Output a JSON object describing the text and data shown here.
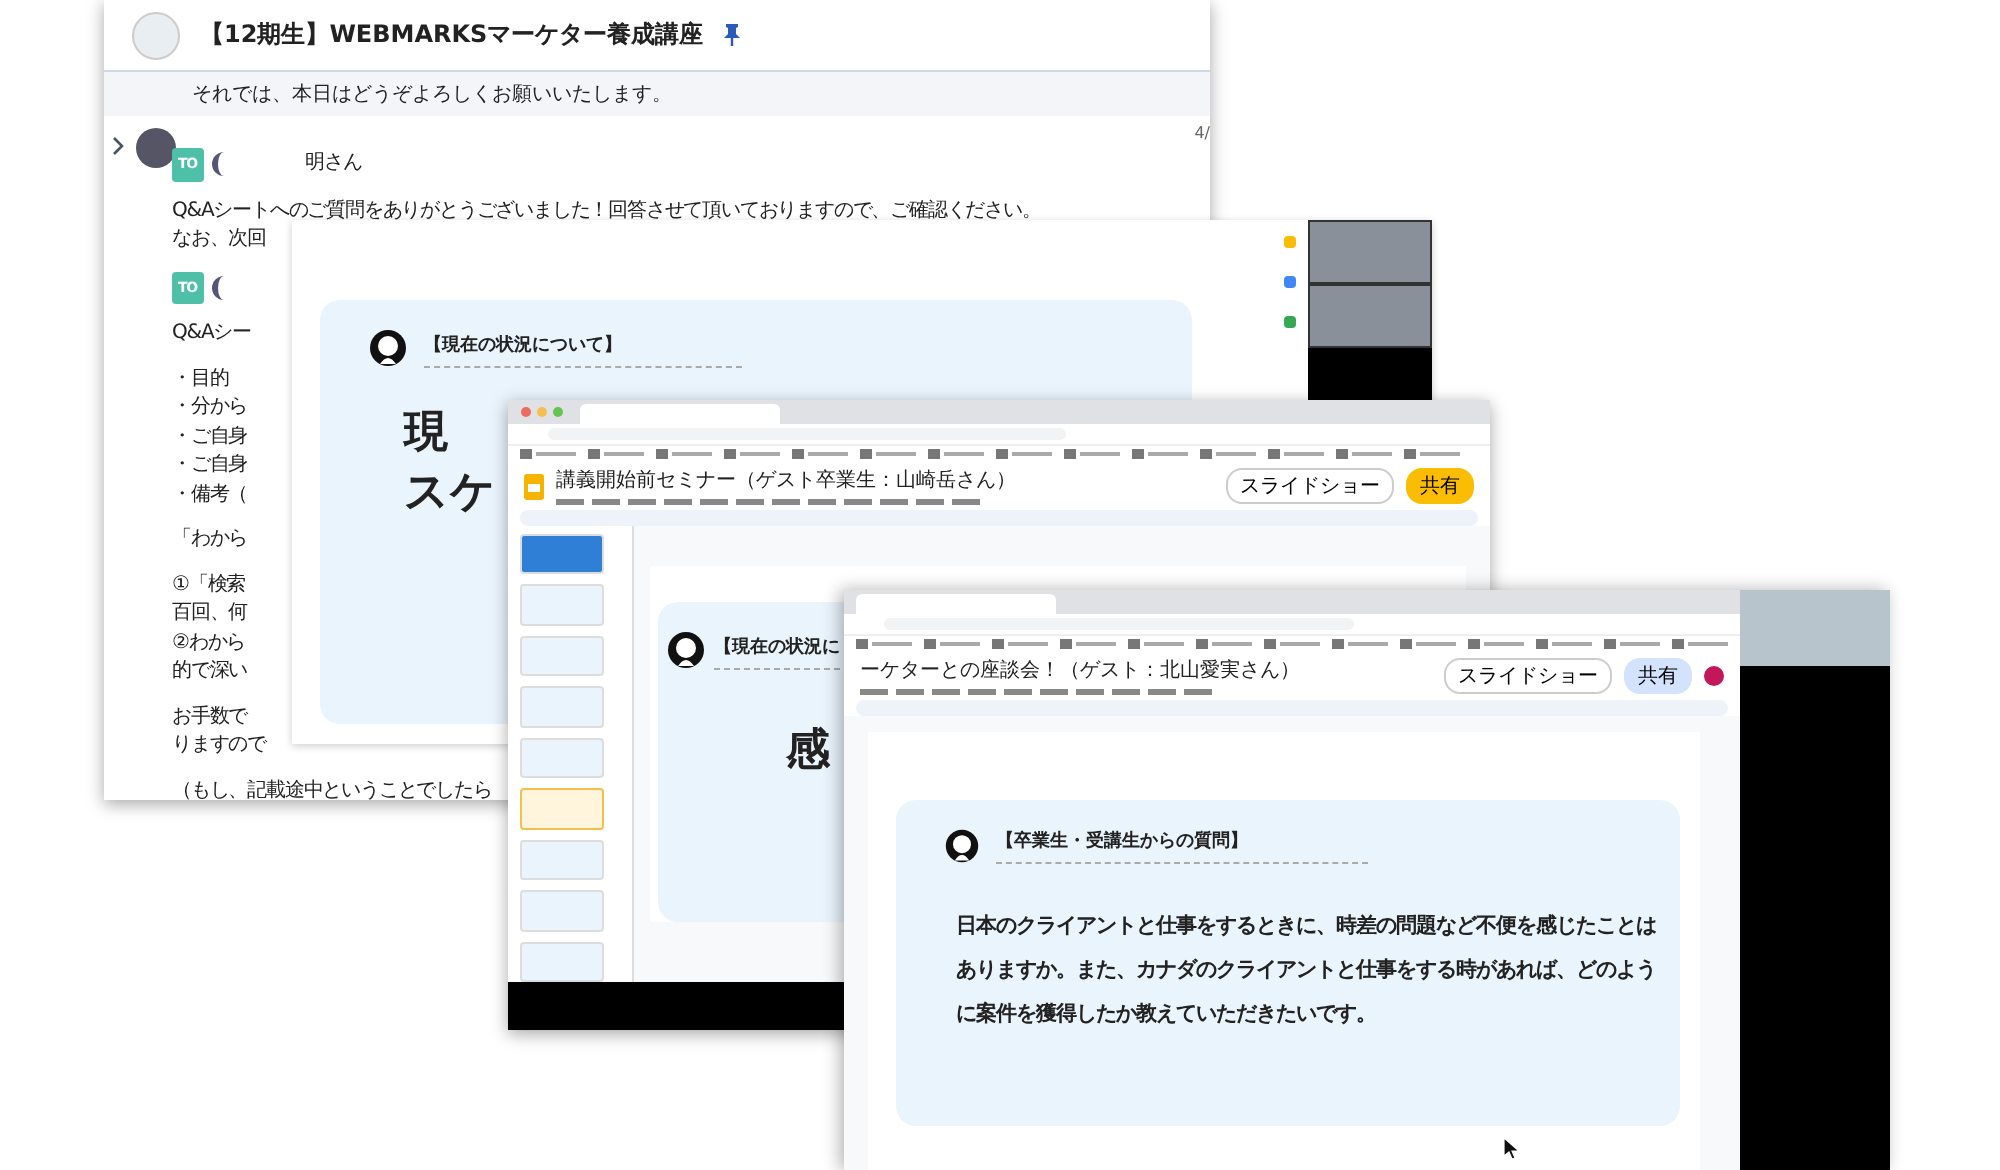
{
  "chat_window": {
    "title": "【12期生】WEBMARKSマーケター養成講座",
    "pinned": true,
    "notice": "それでは、本日はどうぞよろしくお願いいたします。",
    "message": {
      "date": "4/",
      "blocks": [
        {
          "kind": "to",
          "badge": "TO",
          "text": "明さん"
        },
        {
          "kind": "paragraph",
          "lines": [
            "Q&Aシートへのご質問をありがとうございました！回答させて頂いておりますので、ご確認ください。",
            "なお、次回"
          ]
        },
        {
          "kind": "to",
          "badge": "TO"
        },
        {
          "kind": "paragraph",
          "lines": [
            "Q&Aシー"
          ]
        },
        {
          "kind": "paragraph",
          "lines": [
            "・目的",
            "・分から",
            "・ご自身",
            "・ご自身",
            "・備考（"
          ]
        },
        {
          "kind": "paragraph",
          "lines": [
            "「わから"
          ]
        },
        {
          "kind": "paragraph",
          "lines": [
            "①「検索",
            "百回、何",
            "②わから",
            "的で深い"
          ]
        },
        {
          "kind": "paragraph",
          "lines": [
            "お手数で",
            "りますので"
          ]
        },
        {
          "kind": "paragraph",
          "lines": [
            "（もし、記載途中ということでしたら"
          ]
        }
      ]
    }
  },
  "call_window": {
    "slide_heading": "【現在の状況について】",
    "slide_lines": [
      "現",
      "スケ"
    ]
  },
  "slides_window": {
    "title": "講義開始前セミナー（ゲスト卒業生：山崎岳さん）",
    "slideshow_button": "スライドショー",
    "share_button": "共有",
    "thumbnails": [
      {
        "selected": false
      },
      {
        "selected": false
      },
      {
        "selected": false
      },
      {
        "selected": false
      },
      {
        "selected": false
      },
      {
        "selected": true
      },
      {
        "selected": false
      },
      {
        "selected": false
      },
      {
        "selected": false
      }
    ],
    "slide_heading": "【現在の状況に",
    "slide_lines": [
      "感"
    ]
  },
  "meeting_window": {
    "title": "ーケターとの座談会！（ゲスト：北山愛実さん）",
    "slideshow_button": "スライドショー",
    "share_button": "共有",
    "slide_heading": "【卒業生・受講生からの質問】",
    "question": "日本のクライアントと仕事をするときに、時差の問題など不便を感じたことはありますか。また、カナダのクライアントと仕事をする時があれば、どのように案件を獲得したか教えていただきたいです。"
  }
}
